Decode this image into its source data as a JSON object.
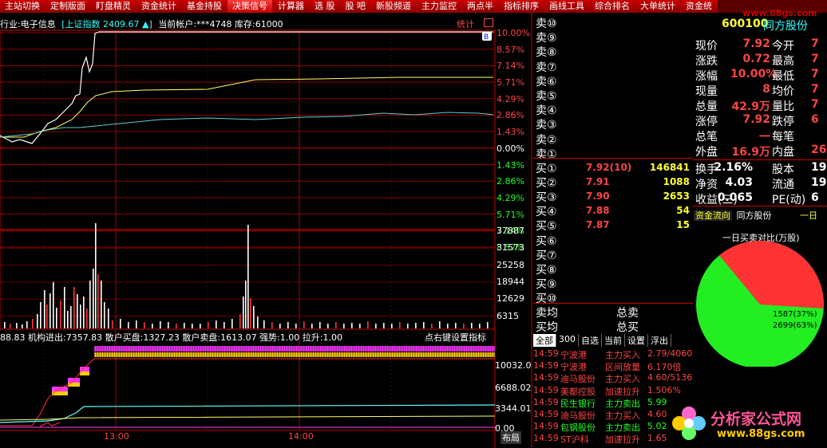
{
  "toolbar": [
    "主站切换",
    "定制版面",
    "盯盘精灵",
    "资金统计",
    "基金持股",
    "决策信号",
    "计算器",
    "选 股",
    "股 吧",
    "新股频道",
    "主力监控",
    "两点半",
    "指标排序",
    "画线工具",
    "综合排名",
    "大单统计",
    "资金统"
  ],
  "toolbar_active_index": 5,
  "watermark": "www.88gs.com",
  "header": {
    "industry": "行业:电子信息",
    "index_name": "[上证指数",
    "index_value": "2409.67",
    "index_arrow": "▲]",
    "account": "当前帐户:***4748",
    "stock": "库存:61000",
    "stats_label": "统计",
    "badge": "B"
  },
  "price_axis": {
    "up": [
      "10.00%",
      "8.57%",
      "7.14%",
      "5.71%",
      "4.29%",
      "2.86%",
      "1.43%"
    ],
    "zero": "0.00%",
    "down": [
      "1.43%",
      "2.86%",
      "4.29%",
      "5.71%",
      "7.14%",
      "8.57%"
    ]
  },
  "volume_axis": [
    "37887",
    "31573",
    "25258",
    "18944",
    "12629",
    "6315"
  ],
  "indicator": {
    "line": "88.83  机构进出:7357.83  散户买盘:1327.23  散户卖盘:1613.07  强势:1.00  拉升:1.00",
    "hint": "点右键设置指标",
    "axis": [
      "10032.0",
      "6688.02",
      "3344.01",
      "0.00"
    ]
  },
  "time_axis": [
    "13:00",
    "14:00"
  ],
  "bottom_label": "布局",
  "order_book": {
    "sell_labels": [
      "卖⑩",
      "卖⑨",
      "卖⑧",
      "卖⑦",
      "卖⑥",
      "卖⑤",
      "卖④",
      "卖③",
      "卖②",
      "卖①"
    ],
    "buy_labels": [
      "买①",
      "买②",
      "买③",
      "买④",
      "买⑤",
      "买⑥",
      "买⑦",
      "买⑧",
      "买⑨",
      "买⑩"
    ],
    "buy_prices": [
      "7.92(10)",
      "7.91",
      "7.90",
      "7.88",
      "7.87"
    ],
    "buy_vols": [
      "146841",
      "1088",
      "2653",
      "54",
      "15"
    ],
    "avg_sell": "卖均",
    "total_sell": "总卖",
    "avg_buy": "买均",
    "total_buy": "总买"
  },
  "quote": {
    "code": "600100",
    "name": "同方股份",
    "rows": [
      {
        "l1": "现价",
        "v1": "7.92",
        "l2": "今开",
        "v2": "7"
      },
      {
        "l1": "涨跌",
        "v1": "0.72",
        "l2": "最高",
        "v2": "7"
      },
      {
        "l1": "涨幅",
        "v1": "10.00%",
        "l2": "最低",
        "v2": "7"
      },
      {
        "l1": "现量",
        "v1": "8",
        "l2": "均价",
        "v2": "7"
      },
      {
        "l1": "总量",
        "v1": "42.9万",
        "l2": "量比",
        "v2": "7"
      },
      {
        "l1": "涨停",
        "v1": "7.92",
        "l2": "跌停",
        "v2": "6"
      },
      {
        "l1": "总笔",
        "v1": "一",
        "l2": "每笔",
        "v2": ""
      },
      {
        "l1": "外盘",
        "v1": "16.9万",
        "l2": "内盘",
        "v2": "26."
      }
    ],
    "rows2": [
      {
        "l1": "换手",
        "v1": "2.16%",
        "l2": "股本",
        "v2": "19."
      },
      {
        "l1": "净资",
        "v1": "4.03",
        "l2": "流通",
        "v2": "19."
      },
      {
        "l1": "收益(三)",
        "v1": "0.065",
        "l2": "PE(动)",
        "v2": "6"
      }
    ]
  },
  "fund_flow": {
    "tab1": "资金流向",
    "tab2": "同方股份",
    "period": "一日",
    "title": "一日买卖对比(万股)",
    "sell_label": "1587(37%)",
    "buy_label": "2699(63%)",
    "sell_pct": 37,
    "buy_pct": 63,
    "sell_color": "#ff3333",
    "buy_color": "#22ee22"
  },
  "tick_tabs": [
    "全部",
    "300",
    "自选",
    "当前",
    "设置",
    "浮出"
  ],
  "ticks": [
    {
      "time": "14:59",
      "name": "宁波港",
      "type": "主力买入",
      "val": "2.79/4060"
    },
    {
      "time": "14:59",
      "name": "宁波港",
      "type": "区间放量",
      "val": "6.170倍"
    },
    {
      "time": "14:59",
      "name": "迪马股份",
      "type": "主力买入",
      "val": "4.60/5136"
    },
    {
      "time": "14:59",
      "name": "美都控股",
      "type": "加速拉升",
      "val": "1.506%"
    },
    {
      "time": "14:59",
      "name": "民生银行",
      "type": "主力卖出",
      "val": "5.99"
    },
    {
      "time": "14:59",
      "name": "迪马股份",
      "type": "主力买入",
      "val": "4.60"
    },
    {
      "time": "14:59",
      "name": "包钢股份",
      "type": "主力卖出",
      "val": "5.02"
    },
    {
      "time": "14:59",
      "name": "ST沪科",
      "type": "加速拉升",
      "val": "1.65"
    }
  ],
  "logo": {
    "title": "分析家公式网",
    "url": "www.88gs.com"
  }
}
